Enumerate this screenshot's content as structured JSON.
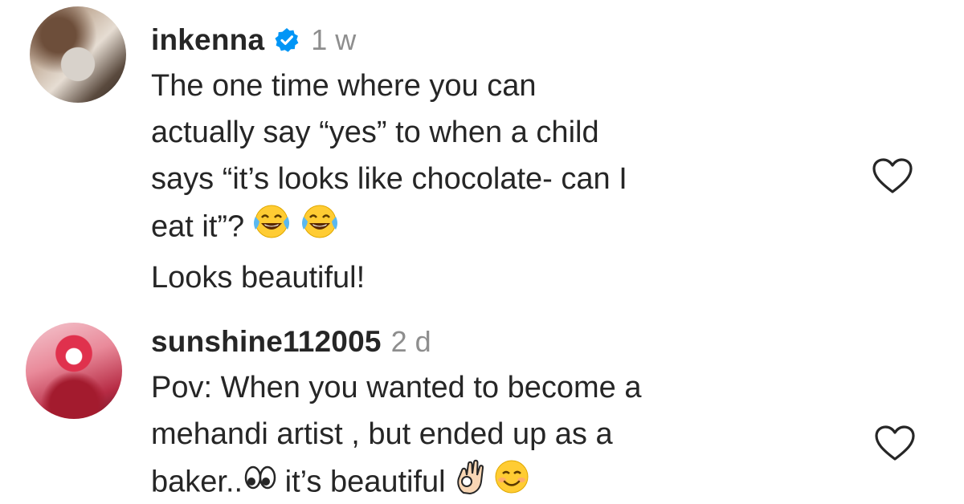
{
  "comments": [
    {
      "username": "inkenna",
      "verified": true,
      "time": "1 w",
      "lines": [
        "The one time where you can",
        "actually say “yes” to when a child",
        "says “it’s looks like chocolate- can I",
        "eat it”?"
      ],
      "line4_emojis": [
        "face-with-tears-of-joy",
        "face-with-tears-of-joy"
      ],
      "last_line": "Looks beautiful!",
      "like_icon": "heart-outline-icon"
    },
    {
      "username": "sunshine112005",
      "verified": false,
      "time": "2 d",
      "lines": [
        "Pov: When you wanted to become a",
        "mehandi artist , but ended up as a"
      ],
      "line3_part1": "baker..",
      "line3_part2": " it’s beautiful ",
      "line3_emojis": [
        "eyes",
        "ok-hand",
        "smiling-face"
      ],
      "like_icon": "heart-outline-icon"
    }
  ],
  "colors": {
    "text": "#262626",
    "secondary": "#8e8e8e",
    "verified_blue": "#0095f6"
  }
}
